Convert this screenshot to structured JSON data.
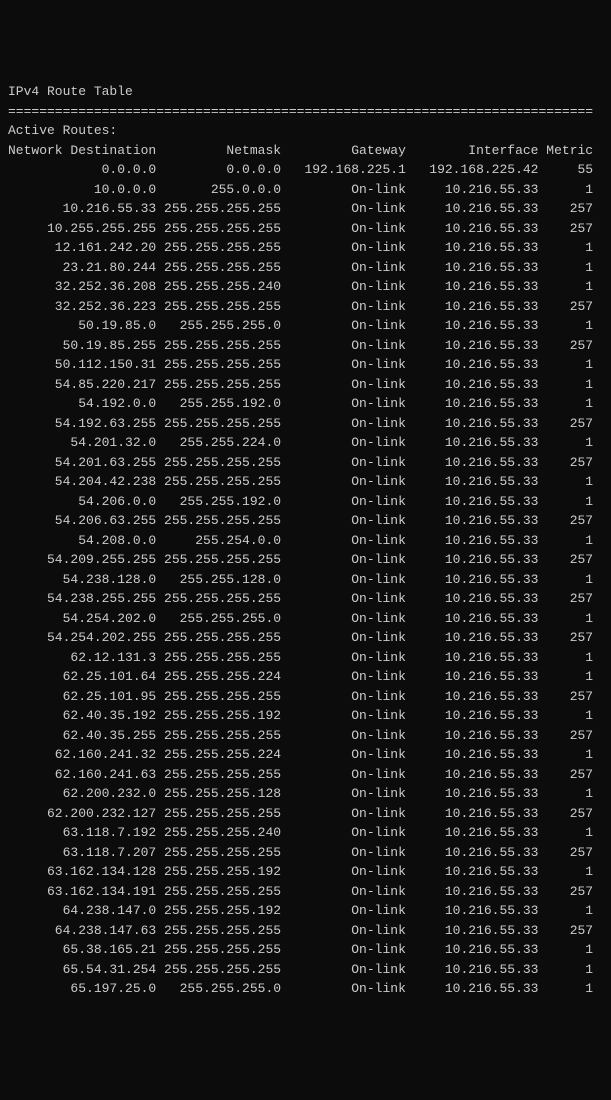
{
  "title": "IPv4 Route Table",
  "separator": "===========================================================================",
  "section_header": "Active Routes:",
  "columns": {
    "dest": "Network Destination",
    "mask": "Netmask",
    "gw": "Gateway",
    "iface": "Interface",
    "metric": "Metric"
  },
  "rows": [
    {
      "dest": "0.0.0.0",
      "mask": "0.0.0.0",
      "gw": "192.168.225.1",
      "iface": "192.168.225.42",
      "metric": "55"
    },
    {
      "dest": "10.0.0.0",
      "mask": "255.0.0.0",
      "gw": "On-link",
      "iface": "10.216.55.33",
      "metric": "1"
    },
    {
      "dest": "10.216.55.33",
      "mask": "255.255.255.255",
      "gw": "On-link",
      "iface": "10.216.55.33",
      "metric": "257"
    },
    {
      "dest": "10.255.255.255",
      "mask": "255.255.255.255",
      "gw": "On-link",
      "iface": "10.216.55.33",
      "metric": "257"
    },
    {
      "dest": "12.161.242.20",
      "mask": "255.255.255.255",
      "gw": "On-link",
      "iface": "10.216.55.33",
      "metric": "1"
    },
    {
      "dest": "23.21.80.244",
      "mask": "255.255.255.255",
      "gw": "On-link",
      "iface": "10.216.55.33",
      "metric": "1"
    },
    {
      "dest": "32.252.36.208",
      "mask": "255.255.255.240",
      "gw": "On-link",
      "iface": "10.216.55.33",
      "metric": "1"
    },
    {
      "dest": "32.252.36.223",
      "mask": "255.255.255.255",
      "gw": "On-link",
      "iface": "10.216.55.33",
      "metric": "257"
    },
    {
      "dest": "50.19.85.0",
      "mask": "255.255.255.0",
      "gw": "On-link",
      "iface": "10.216.55.33",
      "metric": "1"
    },
    {
      "dest": "50.19.85.255",
      "mask": "255.255.255.255",
      "gw": "On-link",
      "iface": "10.216.55.33",
      "metric": "257"
    },
    {
      "dest": "50.112.150.31",
      "mask": "255.255.255.255",
      "gw": "On-link",
      "iface": "10.216.55.33",
      "metric": "1"
    },
    {
      "dest": "54.85.220.217",
      "mask": "255.255.255.255",
      "gw": "On-link",
      "iface": "10.216.55.33",
      "metric": "1"
    },
    {
      "dest": "54.192.0.0",
      "mask": "255.255.192.0",
      "gw": "On-link",
      "iface": "10.216.55.33",
      "metric": "1"
    },
    {
      "dest": "54.192.63.255",
      "mask": "255.255.255.255",
      "gw": "On-link",
      "iface": "10.216.55.33",
      "metric": "257"
    },
    {
      "dest": "54.201.32.0",
      "mask": "255.255.224.0",
      "gw": "On-link",
      "iface": "10.216.55.33",
      "metric": "1"
    },
    {
      "dest": "54.201.63.255",
      "mask": "255.255.255.255",
      "gw": "On-link",
      "iface": "10.216.55.33",
      "metric": "257"
    },
    {
      "dest": "54.204.42.238",
      "mask": "255.255.255.255",
      "gw": "On-link",
      "iface": "10.216.55.33",
      "metric": "1"
    },
    {
      "dest": "54.206.0.0",
      "mask": "255.255.192.0",
      "gw": "On-link",
      "iface": "10.216.55.33",
      "metric": "1"
    },
    {
      "dest": "54.206.63.255",
      "mask": "255.255.255.255",
      "gw": "On-link",
      "iface": "10.216.55.33",
      "metric": "257"
    },
    {
      "dest": "54.208.0.0",
      "mask": "255.254.0.0",
      "gw": "On-link",
      "iface": "10.216.55.33",
      "metric": "1"
    },
    {
      "dest": "54.209.255.255",
      "mask": "255.255.255.255",
      "gw": "On-link",
      "iface": "10.216.55.33",
      "metric": "257"
    },
    {
      "dest": "54.238.128.0",
      "mask": "255.255.128.0",
      "gw": "On-link",
      "iface": "10.216.55.33",
      "metric": "1"
    },
    {
      "dest": "54.238.255.255",
      "mask": "255.255.255.255",
      "gw": "On-link",
      "iface": "10.216.55.33",
      "metric": "257"
    },
    {
      "dest": "54.254.202.0",
      "mask": "255.255.255.0",
      "gw": "On-link",
      "iface": "10.216.55.33",
      "metric": "1"
    },
    {
      "dest": "54.254.202.255",
      "mask": "255.255.255.255",
      "gw": "On-link",
      "iface": "10.216.55.33",
      "metric": "257"
    },
    {
      "dest": "62.12.131.3",
      "mask": "255.255.255.255",
      "gw": "On-link",
      "iface": "10.216.55.33",
      "metric": "1"
    },
    {
      "dest": "62.25.101.64",
      "mask": "255.255.255.224",
      "gw": "On-link",
      "iface": "10.216.55.33",
      "metric": "1"
    },
    {
      "dest": "62.25.101.95",
      "mask": "255.255.255.255",
      "gw": "On-link",
      "iface": "10.216.55.33",
      "metric": "257"
    },
    {
      "dest": "62.40.35.192",
      "mask": "255.255.255.192",
      "gw": "On-link",
      "iface": "10.216.55.33",
      "metric": "1"
    },
    {
      "dest": "62.40.35.255",
      "mask": "255.255.255.255",
      "gw": "On-link",
      "iface": "10.216.55.33",
      "metric": "257"
    },
    {
      "dest": "62.160.241.32",
      "mask": "255.255.255.224",
      "gw": "On-link",
      "iface": "10.216.55.33",
      "metric": "1"
    },
    {
      "dest": "62.160.241.63",
      "mask": "255.255.255.255",
      "gw": "On-link",
      "iface": "10.216.55.33",
      "metric": "257"
    },
    {
      "dest": "62.200.232.0",
      "mask": "255.255.255.128",
      "gw": "On-link",
      "iface": "10.216.55.33",
      "metric": "1"
    },
    {
      "dest": "62.200.232.127",
      "mask": "255.255.255.255",
      "gw": "On-link",
      "iface": "10.216.55.33",
      "metric": "257"
    },
    {
      "dest": "63.118.7.192",
      "mask": "255.255.255.240",
      "gw": "On-link",
      "iface": "10.216.55.33",
      "metric": "1"
    },
    {
      "dest": "63.118.7.207",
      "mask": "255.255.255.255",
      "gw": "On-link",
      "iface": "10.216.55.33",
      "metric": "257"
    },
    {
      "dest": "63.162.134.128",
      "mask": "255.255.255.192",
      "gw": "On-link",
      "iface": "10.216.55.33",
      "metric": "1"
    },
    {
      "dest": "63.162.134.191",
      "mask": "255.255.255.255",
      "gw": "On-link",
      "iface": "10.216.55.33",
      "metric": "257"
    },
    {
      "dest": "64.238.147.0",
      "mask": "255.255.255.192",
      "gw": "On-link",
      "iface": "10.216.55.33",
      "metric": "1"
    },
    {
      "dest": "64.238.147.63",
      "mask": "255.255.255.255",
      "gw": "On-link",
      "iface": "10.216.55.33",
      "metric": "257"
    },
    {
      "dest": "65.38.165.21",
      "mask": "255.255.255.255",
      "gw": "On-link",
      "iface": "10.216.55.33",
      "metric": "1"
    },
    {
      "dest": "65.54.31.254",
      "mask": "255.255.255.255",
      "gw": "On-link",
      "iface": "10.216.55.33",
      "metric": "1"
    },
    {
      "dest": "65.197.25.0",
      "mask": "255.255.255.0",
      "gw": "On-link",
      "iface": "10.216.55.33",
      "metric": "1"
    }
  ]
}
